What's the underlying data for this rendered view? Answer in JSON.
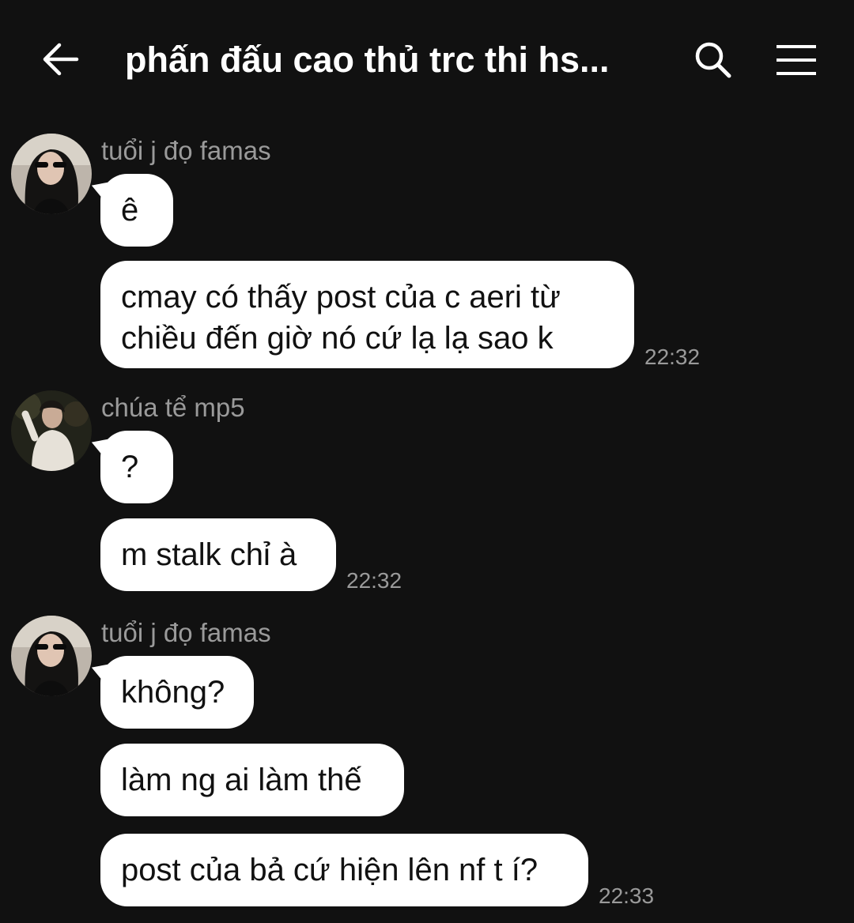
{
  "header": {
    "title": "phấn đấu cao thủ trc thi hs..."
  },
  "groups": [
    {
      "sender": "tuổi j đọ famas",
      "messages": [
        "ê",
        "cmay có thấy post của c aeri từ chiều đến giờ nó cứ lạ lạ sao k"
      ],
      "time": "22:32"
    },
    {
      "sender": "chúa tể mp5",
      "messages": [
        "?",
        "m stalk chỉ à"
      ],
      "time": "22:32"
    },
    {
      "sender": "tuổi j đọ famas",
      "messages": [
        "không?",
        "làm ng ai làm thế",
        "post của bả cứ hiện lên nf t í?"
      ],
      "time": "22:33"
    }
  ],
  "icons": {
    "back": "arrow-left-icon",
    "search": "search-icon",
    "menu": "hamburger-menu-icon"
  },
  "colors": {
    "background": "#111111",
    "bubble": "#ffffff",
    "bubble_text": "#111111",
    "meta_text": "#9a9a9a",
    "header_text": "#ffffff"
  }
}
